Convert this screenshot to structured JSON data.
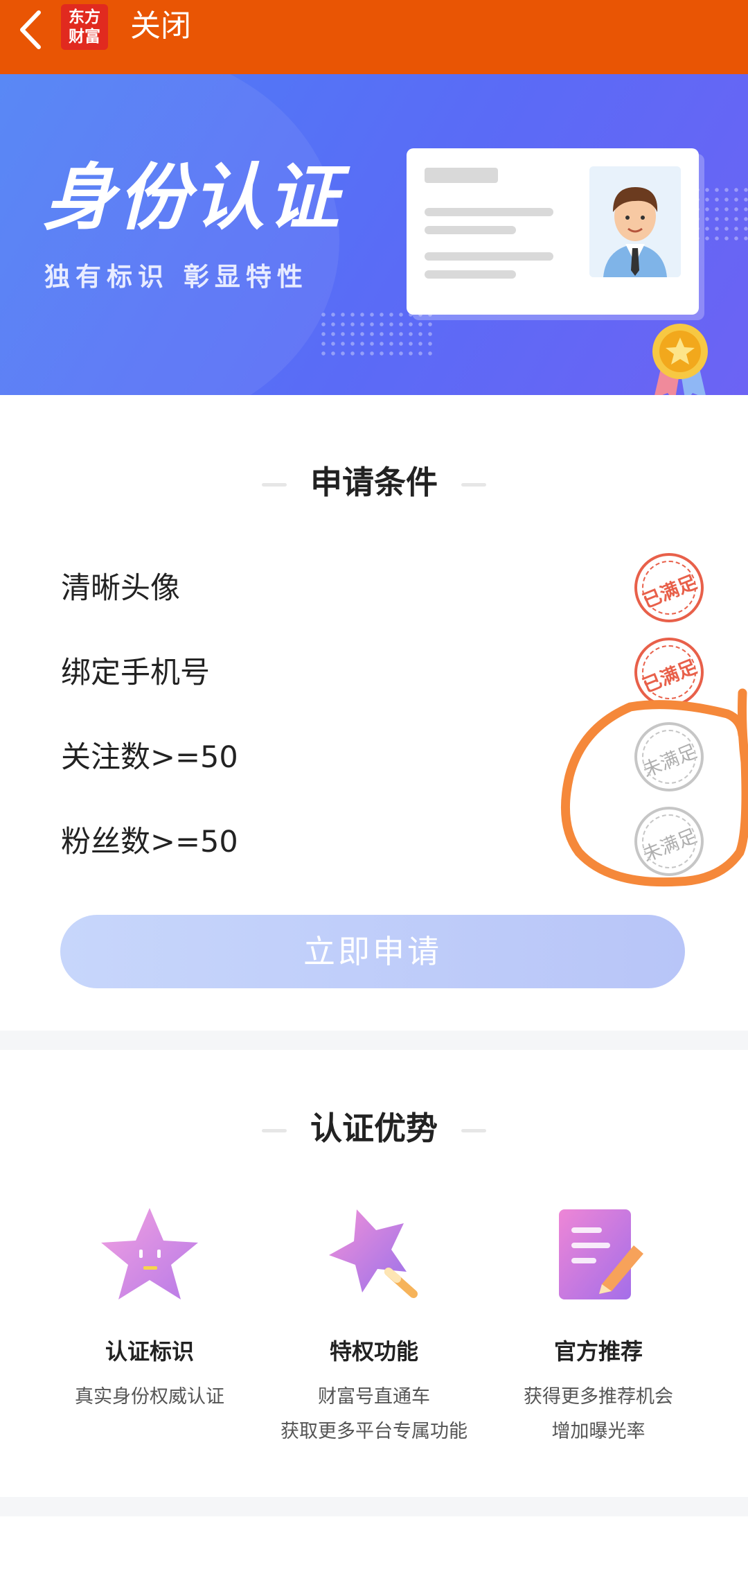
{
  "topbar": {
    "logo_line1": "东方",
    "logo_line2": "财富",
    "close_label": "关闭"
  },
  "banner": {
    "title": "身份认证",
    "subtitle": "独有标识 彰显特性"
  },
  "conditions": {
    "title": "申请条件",
    "items": [
      {
        "label": "清晰头像",
        "status": "已满足"
      },
      {
        "label": "绑定手机号",
        "status": "已满足"
      },
      {
        "label": "关注数>=50",
        "status": "未满足"
      },
      {
        "label": "粉丝数>=50",
        "status": "未满足"
      }
    ],
    "apply_label": "立即申请"
  },
  "advantages": {
    "title": "认证优势",
    "items": [
      {
        "name": "认证标识",
        "desc1": "真实身份权威认证",
        "desc2": ""
      },
      {
        "name": "特权功能",
        "desc1": "财富号直通车",
        "desc2": "获取更多平台专属功能"
      },
      {
        "name": "官方推荐",
        "desc1": "获得更多推荐机会",
        "desc2": "增加曝光率"
      }
    ]
  },
  "colors": {
    "topbar": "#e95504",
    "stamp_ok": "#e8604a",
    "stamp_no": "#b8b8b8",
    "annotation": "#f5883a"
  },
  "icons": [
    "back-arrow-icon",
    "star-face-icon",
    "shooting-star-icon",
    "document-pen-icon",
    "medal-icon"
  ]
}
